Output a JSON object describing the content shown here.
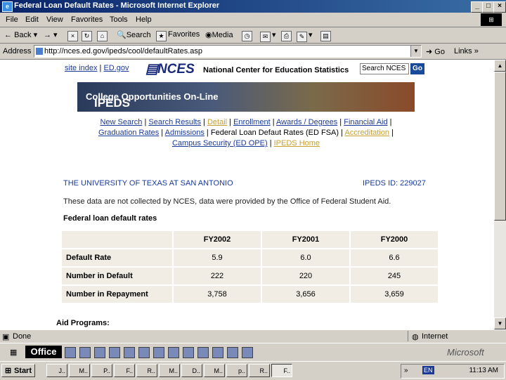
{
  "window": {
    "title": "Federal Loan Default Rates - Microsoft Internet Explorer"
  },
  "menu": [
    "File",
    "Edit",
    "View",
    "Favorites",
    "Tools",
    "Help"
  ],
  "toolbar": {
    "back": "Back",
    "search": "Search",
    "favorites": "Favorites",
    "media": "Media"
  },
  "address": {
    "label": "Address",
    "url": "http://nces.ed.gov/ipeds/cool/defaultRates.asp",
    "go": "Go",
    "links": "Links"
  },
  "page": {
    "site_index": "site index",
    "ed_gov": "ED.gov",
    "nces_mark": "NCES",
    "nces_name": "National Center for Education Statistics",
    "search_value": "Search NCES",
    "search_go": "Go",
    "banner_main": "IPEDS",
    "banner_sub": "College Opportunities On-Line",
    "nav": {
      "new_search": "New Search",
      "search_results": "Search Results",
      "detail": "Detail",
      "enrollment": "Enrollment",
      "awards": "Awards / Degrees",
      "financial_aid": "Financial Aid",
      "graduation": "Graduation Rates",
      "admissions": "Admissions",
      "current": "Federal Loan Defaut Rates (ED FSA)",
      "accreditation": "Accreditation",
      "campus_security": "Campus Security (ED OPE)",
      "ipeds_home": "IPEDS Home"
    },
    "school": "THE UNIVERSITY OF TEXAS AT SAN ANTONIO",
    "ipeds_id": "IPEDS ID: 229027",
    "note": "These data are not collected by NCES, data were provided by the Office of Federal Student Aid.",
    "table_title": "Federal loan default rates",
    "table": {
      "headers": [
        "",
        "FY2002",
        "FY2001",
        "FY2000"
      ],
      "rows": [
        {
          "label": "Default Rate",
          "values": [
            "5.9",
            "6.0",
            "6.6"
          ]
        },
        {
          "label": "Number in Default",
          "values": [
            "222",
            "220",
            "245"
          ]
        },
        {
          "label": "Number in Repayment",
          "values": [
            "3,758",
            "3,656",
            "3,659"
          ]
        }
      ]
    },
    "aid_programs": "Aid Programs:"
  },
  "status": {
    "left": "Done",
    "zone": "Internet"
  },
  "office": {
    "label": "Office",
    "brand": "Microsoft"
  },
  "taskbar": {
    "start": "Start",
    "tasks": [
      "J..",
      "M..",
      "P..",
      "F..",
      "R..",
      "M..",
      "D..",
      "M..",
      "p..",
      "R..",
      "F.."
    ],
    "lang": "EN",
    "clock": "11:13 AM"
  }
}
